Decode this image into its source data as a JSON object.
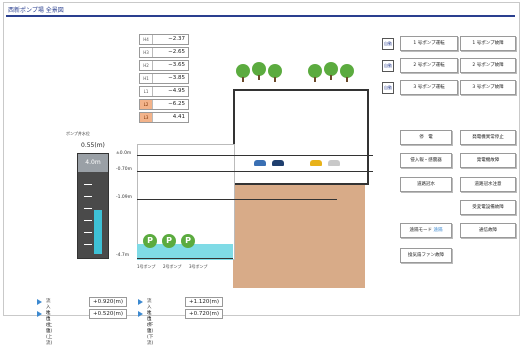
{
  "header": {
    "title": "西新ポンプ場 全景図"
  },
  "levels": [
    {
      "label": "H4",
      "value": "−2.37",
      "alert": false
    },
    {
      "label": "H3",
      "value": "−2.65",
      "alert": false
    },
    {
      "label": "H2",
      "value": "−3.65",
      "alert": false
    },
    {
      "label": "H1",
      "value": "−3.85",
      "alert": false
    },
    {
      "label": "L1",
      "value": "−4.95",
      "alert": false
    },
    {
      "label": "L2",
      "value": "−6.25",
      "alert": true
    },
    {
      "label": "L3",
      "value": "4.41",
      "alert": true
    }
  ],
  "gauge": {
    "title": "ポンプ井水位",
    "value": "0.55(m)",
    "header": "4.0m",
    "fill_fraction": 0.55
  },
  "section_levels": [
    {
      "text": "±0.0m"
    },
    {
      "text": "-0.70m"
    },
    {
      "text": "-1.09m"
    },
    {
      "text": "-4.7m"
    }
  ],
  "pumps": [
    {
      "icon": "P",
      "label": "1号ポンプ"
    },
    {
      "icon": "P",
      "label": "2号ポンプ"
    },
    {
      "icon": "P",
      "label": "3号ポンプ"
    }
  ],
  "pump_status": [
    {
      "mini": "自動",
      "run": "1 号ポンプ運転",
      "fault": "1 号ポンプ故障"
    },
    {
      "mini": "自動",
      "run": "2 号ポンプ運転",
      "fault": "2 号ポンプ故障"
    },
    {
      "mini": "自動",
      "run": "3 号ポンプ運転",
      "fault": "3 号ポンプ故障"
    }
  ],
  "controls": {
    "outage": "停　電",
    "gen_trip": "発電機異常停止",
    "intrusion": "侵入報・感震器",
    "gen_fault": "発電機故障",
    "road_flood": "道路冠水",
    "flood_alarm": "道路冠水注意",
    "pump_alarm": "受変電設備故障",
    "remote_mode": "遠隔モード",
    "remote_value": "遠隔",
    "comm_fault": "通信故障",
    "fan_fault": "換気扇ファン故障"
  },
  "readings": [
    {
      "label": "流入水位(上流)",
      "value": "+0.920(m)"
    },
    {
      "label": "流入水位(下流)",
      "value": "+1.120(m)"
    },
    {
      "label": "吐出水位(上流)",
      "value": "+0.520(m)"
    },
    {
      "label": "吐出水位(下流)",
      "value": "+0.720(m)"
    }
  ],
  "colors": {
    "accent": "#2a3f8f",
    "ground": "#d8ab88",
    "water": "#3ec1d6",
    "pump": "#5bab3f"
  }
}
